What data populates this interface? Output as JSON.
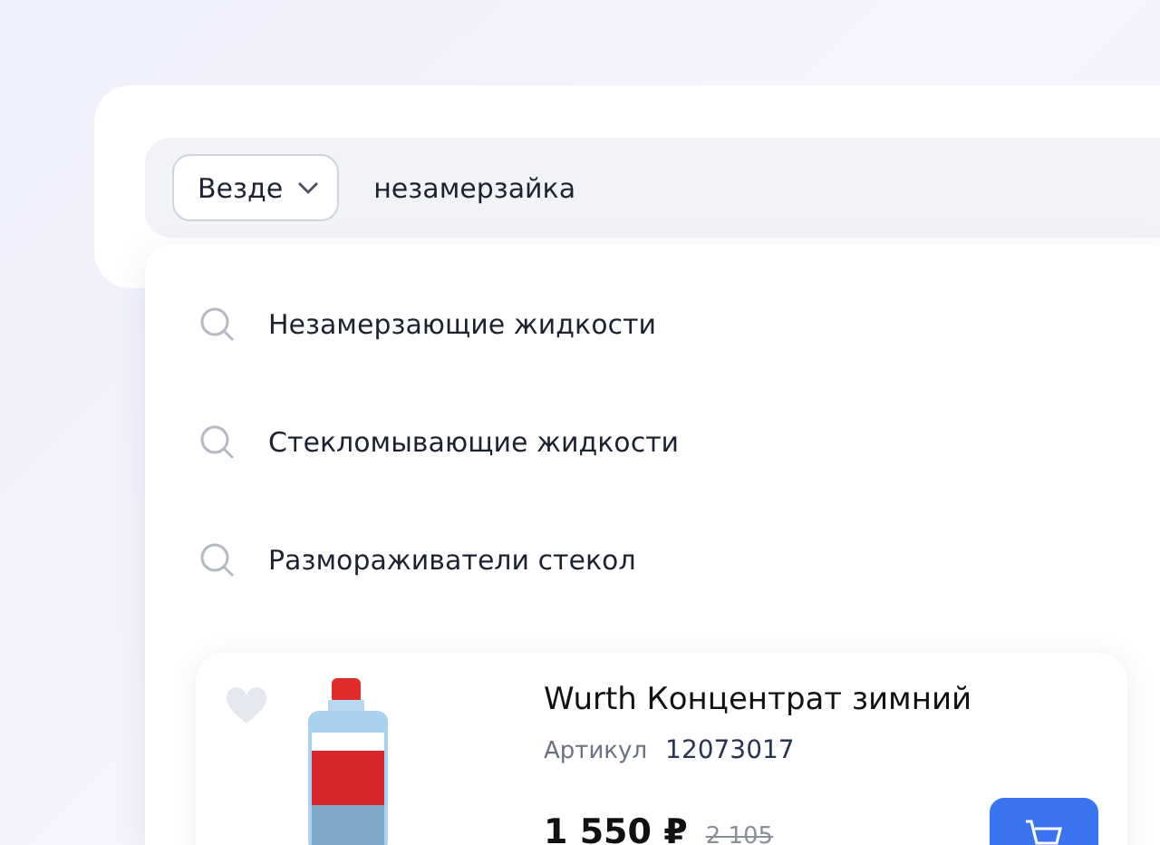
{
  "search": {
    "scope": "Везде",
    "value": "незамерзайка"
  },
  "suggestions": [
    {
      "label": "Незамерзающие жидкости"
    },
    {
      "label": "Стекломывающие жидкости"
    },
    {
      "label": "Размораживатели стекол"
    }
  ],
  "product": {
    "title": "Wurth Концентрат зимний",
    "sku_label": "Артикул",
    "sku": "12073017",
    "price": "1 550 ₽",
    "old_price": "2 105",
    "favorite": false
  }
}
